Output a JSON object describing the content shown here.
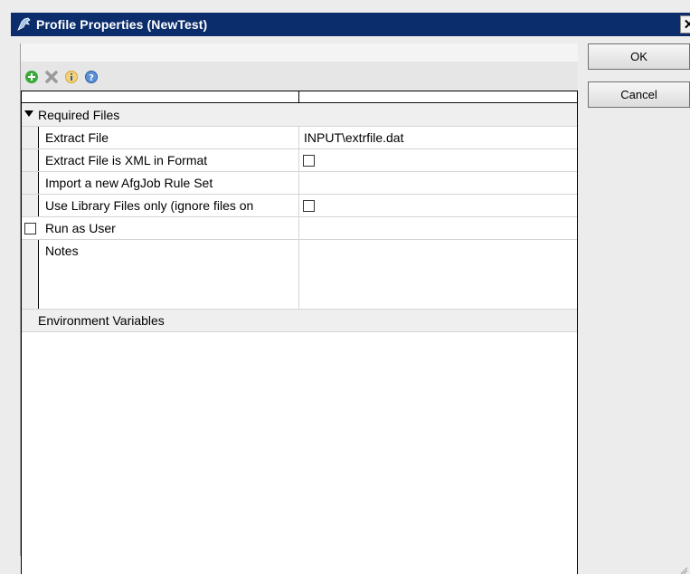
{
  "window": {
    "title": "Profile Properties (NewTest)",
    "close_label": "✕"
  },
  "toolbar": {
    "icons": [
      "add-icon",
      "delete-icon",
      "info-icon",
      "help-icon"
    ]
  },
  "buttons": {
    "ok": "OK",
    "cancel": "Cancel"
  },
  "grid": {
    "category_required": "Required Files",
    "rows": [
      {
        "name": "Extract File",
        "value": "INPUT\\extrfile.dat"
      },
      {
        "name": "Extract File is XML in Format",
        "value_type": "checkbox",
        "checked": false
      },
      {
        "name": "Import a new AfgJob Rule Set",
        "value": ""
      },
      {
        "name": "Use Library Files only (ignore files on",
        "value_type": "checkbox",
        "checked": false
      }
    ],
    "run_as_user": {
      "label": "Run as User",
      "checked": false
    },
    "notes": {
      "label": "Notes",
      "value": ""
    },
    "category_env": "Environment Variables"
  },
  "colors": {
    "titlebar": "#0b2d6b",
    "grid_line": "#d4d4d4",
    "category_bg": "#efefef",
    "accent_line": "#3a5ba8"
  }
}
